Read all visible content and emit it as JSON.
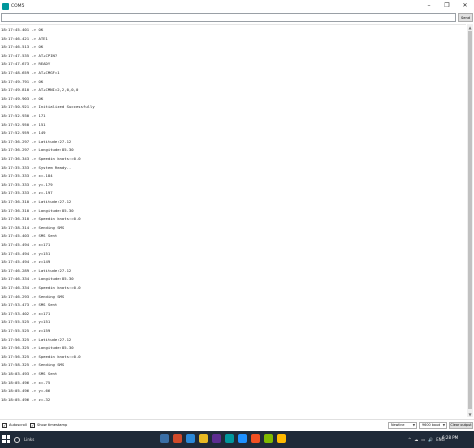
{
  "window": {
    "title": "COM5",
    "minimize_glyph": "–",
    "maximize_glyph": "❐",
    "close_glyph": "✕"
  },
  "send_bar": {
    "input_value": "",
    "send_label": "Send"
  },
  "output_lines": [
    "18:17:45.401 -> OK",
    "18:17:46.421 -> ATE1",
    "18:17:46.513 -> OK",
    "18:17:47.535 -> AT+CPIN?",
    "18:17:47.673 -> READY",
    "18:17:48.659 -> AT+CMGF=1",
    "18:17:49.791 -> OK",
    "18:17:49.810 -> AT+CMNI=2,2,0,0,0",
    "18:17:49.903 -> OK",
    "18:17:50.921 -> Initialized Successfully",
    "18:17:52.930 -> 171",
    "18:17:52.950 -> 151",
    "18:17:52.959 -> 149",
    "18:17:36.297 -> Latitude:27.12",
    "18:17:36.297 -> Longitude:85.30",
    "18:17:36.343 -> Speedin knots:=0.0",
    "18:17:35.333 -> System Ready..",
    "18:17:35.333 -> x=-184",
    "18:17:35.333 -> y=-179",
    "18:17:35.333 -> z=-197",
    "18:17:36.310 -> Latitude:27.12",
    "18:17:36.310 -> Longitude:85.30",
    "18:17:36.310 -> Speedin knots:=0.0",
    "18:17:38.314 -> Sending SMS",
    "18:17:45.403 -> SMS Sent",
    "18:17:45.494 -> x=171",
    "18:17:45.494 -> y=151",
    "18:17:45.494 -> z=149",
    "18:17:46.289 -> Latitude:27.12",
    "18:17:46.334 -> Longitude:85.30",
    "18:17:46.334 -> Speedin knots:=0.0",
    "18:17:46.293 -> Sending SMS",
    "18:17:53.473 -> SMS Sent",
    "18:17:53.402 -> x=171",
    "18:17:55.525 -> y=151",
    "18:17:55.525 -> z=159",
    "18:17:56.325 -> Latitude:27.12",
    "18:17:56.325 -> Longitude:85.30",
    "18:17:56.325 -> Speedin knots:=0.0",
    "18:17:58.325 -> Sending SMS",
    "18:18:03.493 -> SMS Sent",
    "18:18:05.496 -> x=-75",
    "18:18:05.496 -> y=-66",
    "18:18:05.496 -> z=-32"
  ],
  "options_bar": {
    "autoscroll_label": "Autoscroll",
    "autoscroll_checked": "✓",
    "timestamp_label": "Show timestamp",
    "timestamp_checked": "✓",
    "line_ending": "Newline",
    "baud_rate": "9600 baud",
    "clear_label": "Clear output"
  },
  "taskbar": {
    "search_text": "Links",
    "time": "6:28 PM",
    "app_colors": [
      "#3a6ea5",
      "#d04a2a",
      "#2b88d8",
      "#e8b923",
      "#5c2d91",
      "#00979c",
      "#1e90ff",
      "#f25022",
      "#7fba00",
      "#ffb900"
    ],
    "tray_icons": [
      "^",
      "☁",
      "▭",
      "🔊",
      "ENG"
    ]
  }
}
